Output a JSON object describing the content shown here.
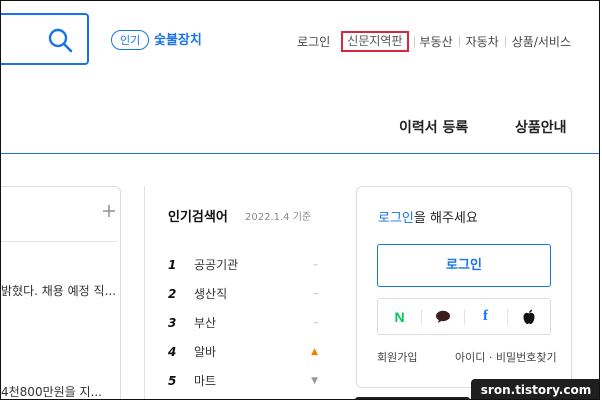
{
  "header": {
    "trend_badge": "인기",
    "trend_keyword": "숯불장치",
    "nav": [
      {
        "label": "로그인",
        "highlighted": false
      },
      {
        "label": "신문지역판",
        "highlighted": true
      },
      {
        "label": "부동산",
        "highlighted": false
      },
      {
        "label": "자동차",
        "highlighted": false
      },
      {
        "label": "상품/서비스",
        "highlighted": false
      }
    ]
  },
  "subnav": {
    "resume_register": "이력서 등록",
    "product_guide": "상품안내"
  },
  "news": {
    "lines": [
      "밝혔다. 채용 예정 직...",
      "4천800만원을 지..."
    ]
  },
  "popular": {
    "title": "인기검색어",
    "date": "2022.1.4 기준",
    "items": [
      {
        "rank": "1",
        "keyword": "공공기관",
        "trend": "–"
      },
      {
        "rank": "2",
        "keyword": "생산직",
        "trend": "–"
      },
      {
        "rank": "3",
        "keyword": "부산",
        "trend": "–"
      },
      {
        "rank": "4",
        "keyword": "알바",
        "trend": "▲"
      },
      {
        "rank": "5",
        "keyword": "마트",
        "trend": "▼"
      }
    ]
  },
  "login": {
    "message_link": "로그인",
    "message_rest": "을 해주세요",
    "button": "로그인",
    "social": [
      {
        "name": "naver",
        "glyph": "N"
      },
      {
        "name": "kakao",
        "glyph": ""
      },
      {
        "name": "facebook",
        "glyph": "f"
      },
      {
        "name": "apple",
        "glyph": ""
      }
    ],
    "signup": "회원가입",
    "find_account": "아이디 · 비밀번호찾기"
  },
  "watermark": "sron.tistory.com",
  "colors": {
    "accent": "#1a73e8",
    "highlight_border": "#d7263d",
    "naver": "#03c75a",
    "facebook": "#1877f2",
    "trend_up": "#f57c00"
  }
}
